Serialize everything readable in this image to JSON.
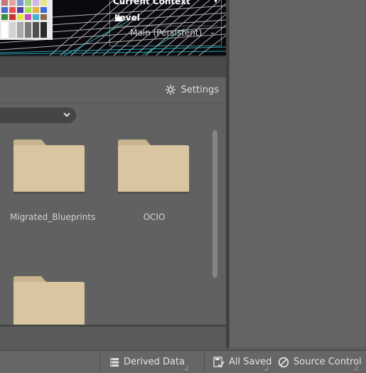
{
  "viewport": {
    "context_title": "Current Context",
    "level_label": "Level",
    "level_value": "Main (Persistent)"
  },
  "content_browser": {
    "settings_label": "Settings",
    "folders": [
      {
        "name": "Migrated_Blueprints"
      },
      {
        "name": "OCIO"
      },
      {
        "name": ""
      }
    ]
  },
  "statusbar": {
    "derived_data": "Derived Data",
    "all_saved": "All Saved",
    "source_control": "Source Control"
  },
  "colors": {
    "folder": "#d9c5a0",
    "panel": "#616161",
    "accent_cyan": "#78dce6"
  },
  "icons": [
    "gear-icon",
    "chevron-down-icon",
    "level-icon",
    "folder-icon",
    "stack-icon",
    "save-check-icon",
    "no-entry-icon"
  ]
}
